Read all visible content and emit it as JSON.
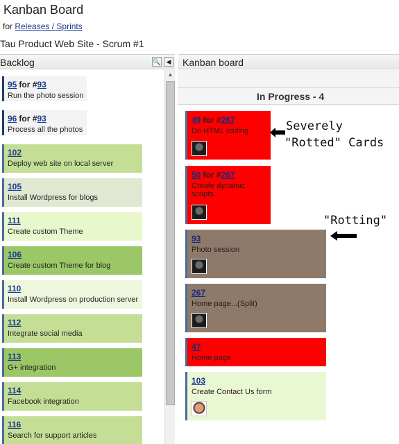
{
  "header": {
    "app_title": "Kanban Board",
    "for_label": "for",
    "for_link": "Releases / Sprints",
    "project_title": "Tau Product Web Site - Scrum #1"
  },
  "backlog": {
    "title": "Backlog",
    "search_btn": "🔍",
    "collapse_btn": "◀",
    "items": [
      {
        "id": "95",
        "for_label": "for #",
        "parent": "93",
        "text": "Run the photo session",
        "color": "#f3f3f3"
      },
      {
        "id": "96",
        "for_label": "for #",
        "parent": "93",
        "text": "Process all the photos",
        "color": "#f3f3f3"
      },
      {
        "id": "102",
        "text": "Deploy web site on local server",
        "color": "#c4df95"
      },
      {
        "id": "105",
        "text": "Install Wordpress for blogs",
        "color": "#dfe8d0"
      },
      {
        "id": "111",
        "text": "Create custom Theme",
        "color": "#e9f7cc"
      },
      {
        "id": "106",
        "text": "Create custom Theme for blog",
        "color": "#9cc766"
      },
      {
        "id": "110",
        "text": "Install Wordpress on production server",
        "color": "#eef7dd"
      },
      {
        "id": "112",
        "text": "Integrate social media",
        "color": "#c4df95"
      },
      {
        "id": "113",
        "text": "G+ integration",
        "color": "#9cc766"
      },
      {
        "id": "114",
        "text": "Facebook integration",
        "color": "#c4df95"
      },
      {
        "id": "116",
        "text": "Search for support articles",
        "color": "#c4df95"
      }
    ]
  },
  "kanban": {
    "title": "Kanban board",
    "column_title": "In Progress - 4",
    "cards": [
      {
        "id": "49",
        "for_label": "for #",
        "parent": "267",
        "text": "Do HTML coding",
        "state": "red"
      },
      {
        "id": "50",
        "for_label": "for #",
        "parent": "267",
        "text": "Create dynamic scripts",
        "state": "red"
      },
      {
        "id": "93",
        "text": "Photo session",
        "state": "brown"
      },
      {
        "id": "267",
        "text": "Home page...(Split)",
        "state": "brown"
      },
      {
        "id": "47",
        "text": "Home page",
        "state": "red"
      },
      {
        "id": "103",
        "text": "Create Contact Us form",
        "state": "green"
      }
    ]
  },
  "annotations": {
    "severely": "Severely",
    "rotted": "\"Rotted\" Cards",
    "rotting": "\"Rotting\""
  },
  "colors": {
    "rotted": "#ff0000",
    "rotting": "#8e7a6b",
    "fresh": "#e9f7d3"
  }
}
